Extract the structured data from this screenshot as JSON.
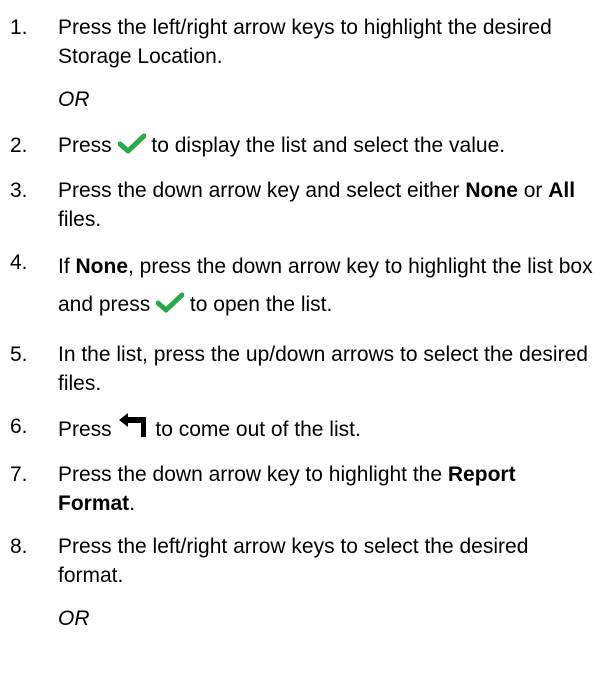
{
  "steps": [
    {
      "num": "1.",
      "text": "Press the left/right arrow keys to highlight the desired Storage Location."
    },
    {
      "num": "2.",
      "before": "Press",
      "after": "to display the list and select the value."
    },
    {
      "num": "3.",
      "before": "Press the down arrow key and select either",
      "bold1": "None",
      "mid": "or",
      "bold2": "All",
      "after": "files."
    },
    {
      "num": "4.",
      "before": "If",
      "bold": "None",
      "mid": ", press the down arrow key to highlight the list box and press",
      "after": "to open the list."
    },
    {
      "num": "5.",
      "text": "In the list, press the up/down arrows to select the desired files."
    },
    {
      "num": "6.",
      "before": "Press",
      "after": "to come out of the list."
    },
    {
      "num": "7.",
      "before": "Press the down arrow key to highlight the",
      "bold": "Report Format",
      "after": "."
    },
    {
      "num": "8.",
      "text": "Press the left/right arrow keys to select the desired format."
    }
  ],
  "or_label": "OR",
  "icons": {
    "check": "check-icon",
    "back": "return-arrow-icon"
  },
  "colors": {
    "check": "#2aa84a",
    "text": "#000000"
  }
}
